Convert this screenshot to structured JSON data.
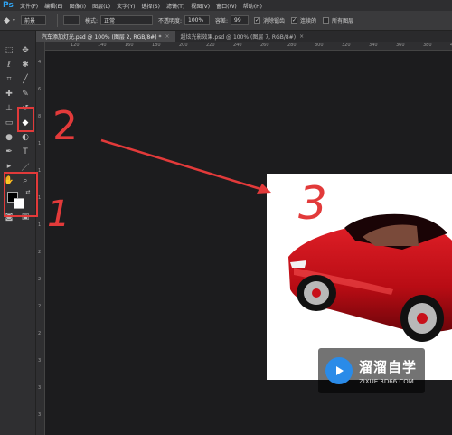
{
  "app": {
    "logo": "Ps"
  },
  "menu": [
    "文件(F)",
    "编辑(E)",
    "图像(I)",
    "图层(L)",
    "文字(Y)",
    "选择(S)",
    "滤镜(T)",
    "视图(V)",
    "窗口(W)",
    "帮助(H)"
  ],
  "options": {
    "tool_value": "前景",
    "mode_label": "模式:",
    "mode_value": "正常",
    "opacity_label": "不透明度:",
    "opacity_value": "100%",
    "tolerance_label": "容差:",
    "tolerance_value": "99",
    "antialias_label": "消除锯齿",
    "contiguous_label": "连续的",
    "all_layers_label": "所有图层"
  },
  "tabs": [
    {
      "label": "汽车添加灯光.psd @ 100% (图层 2, RGB/8#) *",
      "active": true
    },
    {
      "label": "超炫光影效果.psd @ 100% (图层 7, RGB/8#)",
      "active": false
    }
  ],
  "ruler": {
    "h": [
      "120",
      "140",
      "160",
      "180",
      "200",
      "220",
      "240",
      "260",
      "280",
      "300",
      "320",
      "340",
      "360",
      "380",
      "400"
    ],
    "v": [
      "4",
      "6",
      "8",
      "1",
      "1",
      "1",
      "1",
      "2",
      "2",
      "2",
      "2",
      "3",
      "3",
      "3"
    ]
  },
  "annotations": {
    "label_1": "1",
    "label_2": "2",
    "label_3": "3"
  },
  "watermark": {
    "title": "溜溜自学",
    "url": "ZIXUE.3D66.COM"
  },
  "colors": {
    "annotation": "#e23a3a",
    "accent": "#2fa3f2",
    "car_red": "#c8101a"
  }
}
